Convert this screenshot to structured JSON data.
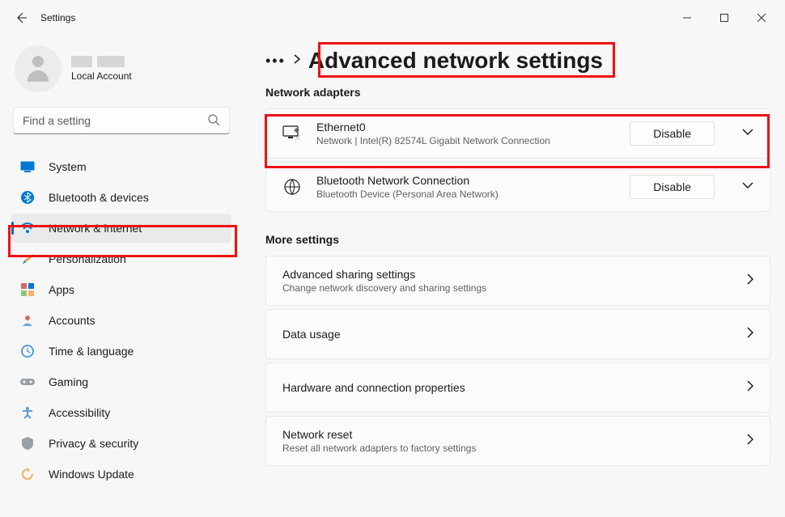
{
  "window": {
    "title": "Settings"
  },
  "profile": {
    "account_type": "Local Account"
  },
  "search": {
    "placeholder": "Find a setting"
  },
  "sidebar": {
    "items": [
      {
        "label": "System"
      },
      {
        "label": "Bluetooth & devices"
      },
      {
        "label": "Network & internet",
        "selected": true
      },
      {
        "label": "Personalization"
      },
      {
        "label": "Apps"
      },
      {
        "label": "Accounts"
      },
      {
        "label": "Time & language"
      },
      {
        "label": "Gaming"
      },
      {
        "label": "Accessibility"
      },
      {
        "label": "Privacy & security"
      },
      {
        "label": "Windows Update"
      }
    ]
  },
  "page": {
    "title": "Advanced network settings",
    "adapters_heading": "Network adapters",
    "adapters": [
      {
        "name": "Ethernet0",
        "description": "Network | Intel(R) 82574L Gigabit Network Connection",
        "action": "Disable"
      },
      {
        "name": "Bluetooth Network Connection",
        "description": "Bluetooth Device (Personal Area Network)",
        "action": "Disable"
      }
    ],
    "more_heading": "More settings",
    "more": [
      {
        "title": "Advanced sharing settings",
        "sub": "Change network discovery and sharing settings"
      },
      {
        "title": "Data usage",
        "sub": ""
      },
      {
        "title": "Hardware and connection properties",
        "sub": ""
      },
      {
        "title": "Network reset",
        "sub": "Reset all network adapters to factory settings"
      }
    ]
  }
}
